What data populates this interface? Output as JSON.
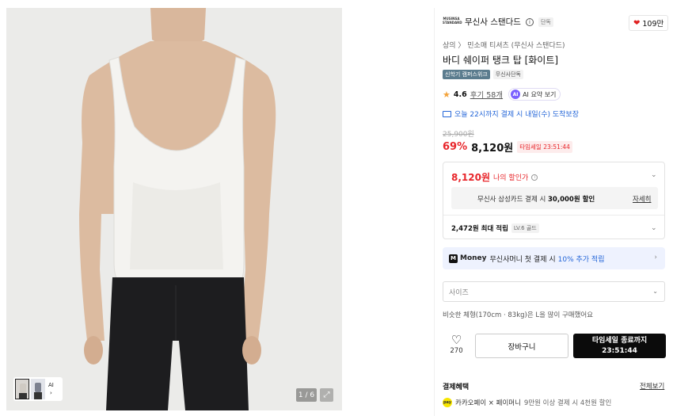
{
  "gallery": {
    "thumb_ai_label": "AI",
    "thumb_more_icon": "chevron-right-icon",
    "counter": "1 / 6",
    "expand_icon": "expand-icon"
  },
  "brand": {
    "logo_text": "MUSINSA STANDARD",
    "name": "무신사 스탠다드",
    "info_icon": "i",
    "exclusive": "단독"
  },
  "likes": {
    "icon": "heart-icon",
    "count": "109만",
    "color": "#e02020"
  },
  "breadcrumb": "상의 〉 민소매 티셔츠 (무신사 스탠다드)",
  "product": {
    "title": "바디 쉐이퍼 탱크 탑 [화이트]",
    "tags": [
      "신학기 캠퍼스위크",
      "무신사단독"
    ]
  },
  "rating": {
    "star_icon": "star-icon",
    "score": "4.6",
    "reviews": "후기 58개",
    "ai_badge": "AI",
    "ai_label": "AI 요약 보기"
  },
  "delivery": {
    "icon": "truck-icon",
    "text": "오늘 22시까지 결제 시 내일(수) 도착보장",
    "color": "#2466d8"
  },
  "price": {
    "original": "25,900원",
    "discount": "69%",
    "sale": "8,120원",
    "timesale": "타임세일 23:51:44",
    "accent_color": "#e8262b"
  },
  "benefits": {
    "my_price": "8,120원",
    "my_price_label": "나의 할인가",
    "card_text_prefix": "무신사 삼성카드 결제 시 ",
    "card_text_bold": "30,000원 할인",
    "card_detail": "자세히",
    "points_bold": "2,472원 최대 적립",
    "level": "LV.6 골드"
  },
  "money_banner": {
    "logo": "M",
    "word": "Money",
    "text": "무신사머니 첫 결제 시",
    "accent": "10% 추가 적립"
  },
  "size_select": {
    "placeholder": "사이즈"
  },
  "size_hint": "비슷한 체형(170cm · 83kg)은 L을 많이 구매했어요",
  "actions": {
    "wish_icon": "heart-outline-icon",
    "wish_count": "270",
    "cart": "장바구니",
    "buy_line1": "타임세일 종료까지",
    "buy_line2": "23:51:44"
  },
  "payment": {
    "header": "결제혜택",
    "view_all": "전체보기",
    "row_icon": "pay",
    "row_main": "카카오페이 × 페이머니",
    "row_detail": "9만원 이상 결제 시 4천원 할인"
  }
}
